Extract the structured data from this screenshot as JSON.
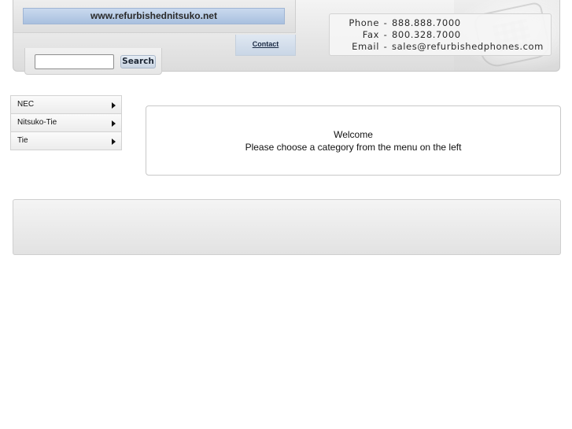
{
  "header": {
    "domain": "www.refurbishednitsuko.net",
    "contact_tab": "Contact",
    "contact_info": [
      {
        "label": "Phone",
        "value": "888.888.7000"
      },
      {
        "label": "Fax",
        "value": "800.328.7000"
      },
      {
        "label": "Email",
        "value": "sales@refurbishedphones.com"
      }
    ],
    "separator": "-"
  },
  "search": {
    "value": "",
    "placeholder": "",
    "button_label": "Search"
  },
  "menu": {
    "items": [
      {
        "label": "NEC"
      },
      {
        "label": "Nitsuko-Tie"
      },
      {
        "label": "Tie"
      }
    ]
  },
  "welcome": {
    "title": "Welcome",
    "message": "Please choose a category from the menu on the left"
  },
  "colors": {
    "domain_bar": "#b7cbe6",
    "contact_tab": "#d3deeb",
    "header_bg": "#e6e6e6"
  },
  "icons": {
    "menu_arrow": "right-triangle-icon",
    "phone_art": "telephone-icon"
  }
}
